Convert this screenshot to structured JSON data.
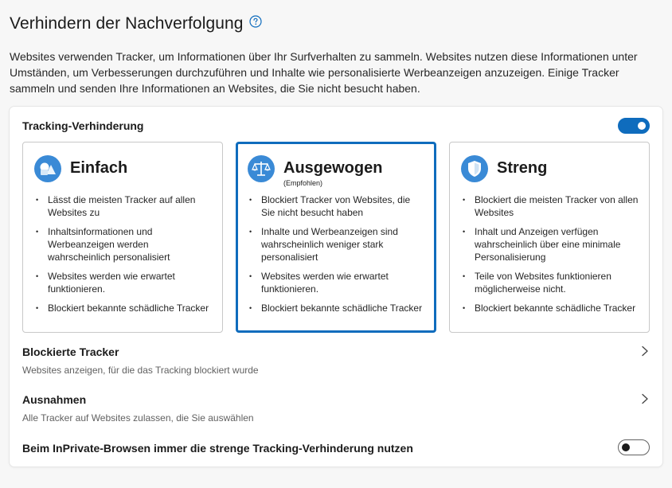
{
  "page": {
    "title": "Verhindern der Nachverfolgung",
    "help_icon": "question-circle-icon",
    "intro": "Websites verwenden Tracker, um Informationen über Ihr Surfverhalten zu sammeln. Websites nutzen diese Informationen unter Umständen, um Verbesserungen durchzuführen und Inhalte wie personalisierte Werbeanzeigen anzuzeigen. Einige Tracker sammeln und senden Ihre Informationen an Websites, die Sie nicht besucht haben."
  },
  "tracking": {
    "label": "Tracking-Verhinderung",
    "enabled": true,
    "selected_level": "Ausgewogen",
    "levels": [
      {
        "title": "Einfach",
        "subtitle": "",
        "icon": "shapes-icon",
        "bullets": [
          "Lässt die meisten Tracker auf allen Websites zu",
          "Inhaltsinformationen und Werbeanzeigen werden wahrscheinlich personalisiert",
          "Websites werden wie erwartet funktionieren.",
          "Blockiert bekannte schädliche Tracker"
        ]
      },
      {
        "title": "Ausgewogen",
        "subtitle": "(Empfohlen)",
        "icon": "scales-icon",
        "bullets": [
          "Blockiert Tracker von Websites, die Sie nicht besucht haben",
          "Inhalte und Werbeanzeigen sind wahrscheinlich weniger stark personalisiert",
          "Websites werden wie erwartet funktionieren.",
          "Blockiert bekannte schädliche Tracker"
        ]
      },
      {
        "title": "Streng",
        "subtitle": "",
        "icon": "shield-icon",
        "bullets": [
          "Blockiert die meisten Tracker von allen Websites",
          "Inhalt und Anzeigen verfügen wahrscheinlich über eine minimale Personalisierung",
          "Teile von Websites funktionieren möglicherweise nicht.",
          "Blockiert bekannte schädliche Tracker"
        ]
      }
    ]
  },
  "blocked_trackers": {
    "title": "Blockierte Tracker",
    "description": "Websites anzeigen, für die das Tracking blockiert wurde"
  },
  "exceptions": {
    "title": "Ausnahmen",
    "description": "Alle Tracker auf Websites zulassen, die Sie auswählen"
  },
  "inprivate": {
    "label": "Beim InPrivate-Browsen immer die strenge Tracking-Verhinderung nutzen",
    "enabled": false
  },
  "colors": {
    "accent": "#0f6cbd",
    "icon_blue": "#3a8ad6"
  }
}
